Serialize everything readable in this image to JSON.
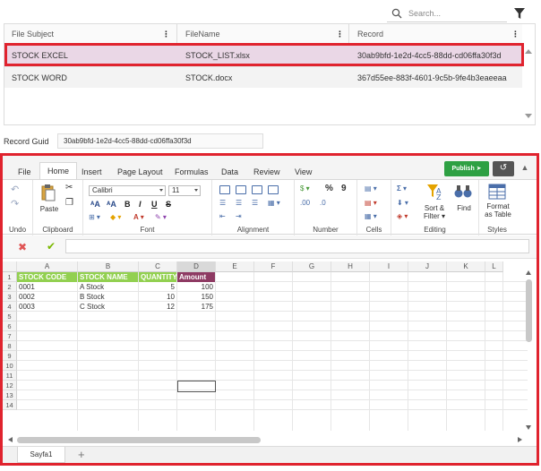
{
  "search": {
    "placeholder": "Search..."
  },
  "grid": {
    "columns": [
      "File Subject",
      "FileName",
      "Record"
    ],
    "rows": [
      {
        "subject": "STOCK EXCEL",
        "filename": "STOCK_LIST.xlsx",
        "record": "30ab9bfd-1e2d-4cc5-88dd-cd06ffa30f3d"
      },
      {
        "subject": "STOCK WORD",
        "filename": "STOCK.docx",
        "record": "367d55ee-883f-4601-9c5b-9fe4b3eaeeaa"
      }
    ]
  },
  "record_guid": {
    "label": "Record Guid",
    "value": "30ab9bfd-1e2d-4cc5-88dd-cd06ffa30f3d"
  },
  "ribbon": {
    "tabs": [
      "File",
      "Home",
      "Insert",
      "Page Layout",
      "Formulas",
      "Data",
      "Review",
      "View"
    ],
    "active_tab": "Home",
    "publish_label": "Publish",
    "font_name": "Calibri",
    "font_size": "11",
    "groups": {
      "undo": "Undo",
      "clipboard": "Clipboard",
      "font": "Font",
      "alignment": "Alignment",
      "number": "Number",
      "cells": "Cells",
      "editing": "Editing",
      "styles": "Styles"
    },
    "paste_label": "Paste",
    "sort_label": "Sort &",
    "filter_label": "Filter ▾",
    "find_label": "Find",
    "format_label_1": "Format",
    "format_label_2": "as Table",
    "percent_symbol": "%",
    "comma_symbol": "9"
  },
  "sheet": {
    "columns": [
      "A",
      "B",
      "C",
      "D",
      "E",
      "F",
      "G",
      "H",
      "I",
      "J",
      "K",
      "L"
    ],
    "row_numbers": [
      "1",
      "2",
      "3",
      "4",
      "5",
      "6",
      "7",
      "8",
      "9",
      "10",
      "11",
      "12",
      "13",
      "14"
    ],
    "header_row": [
      "STOCK CODE",
      "STOCK NAME",
      "QUANTITY",
      "Amount"
    ],
    "data_rows": [
      [
        "0001",
        "A Stock",
        "5",
        "100"
      ],
      [
        "0002",
        "B Stock",
        "10",
        "150"
      ],
      [
        "0003",
        "C Stock",
        "12",
        "175"
      ]
    ],
    "sheet_tab": "Sayfa1",
    "colors": {
      "header_green": "#92d050",
      "header_purple": "#8e3a63",
      "accent_red": "#e0232e",
      "publish_green": "#2ea043"
    }
  }
}
